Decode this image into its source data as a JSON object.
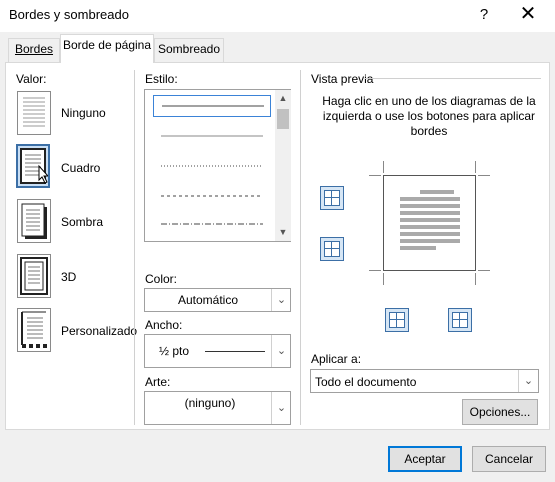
{
  "window": {
    "title": "Bordes y sombreado",
    "help_glyph": "?",
    "close_glyph": "✕"
  },
  "tabs": [
    {
      "label": "Bordes",
      "active": false
    },
    {
      "label": "Borde de página",
      "active": true
    },
    {
      "label": "Sombreado",
      "active": false
    }
  ],
  "setting": {
    "label": "Valor:",
    "options": [
      {
        "label": "Ninguno",
        "icon": "none-page-icon"
      },
      {
        "label": "Cuadro",
        "icon": "box-page-icon",
        "selected": true
      },
      {
        "label": "Sombra",
        "icon": "shadow-page-icon"
      },
      {
        "label": "3D",
        "icon": "3d-page-icon"
      },
      {
        "label": "Personalizado",
        "icon": "custom-page-icon"
      }
    ]
  },
  "style": {
    "label": "Estilo:",
    "line_styles": [
      "solid",
      "solid-thin",
      "dotted",
      "dashed",
      "dash-dot"
    ],
    "color_label": "Color:",
    "color_value": "Automático",
    "width_label": "Ancho:",
    "width_value": "½ pto",
    "art_label": "Arte:",
    "art_value": "(ninguno)"
  },
  "preview": {
    "label": "Vista previa",
    "instructions": "Haga clic en uno de los diagramas de la izquierda o use los botones para aplicar bordes",
    "apply_label": "Aplicar a:",
    "apply_value": "Todo el documento",
    "options_button": "Opciones..."
  },
  "footer": {
    "ok_button": "Aceptar",
    "cancel_button": "Cancelar"
  },
  "colors": {
    "accent": "#0078d7",
    "selection": "#c9dff5",
    "border": "#3c6fa6"
  }
}
